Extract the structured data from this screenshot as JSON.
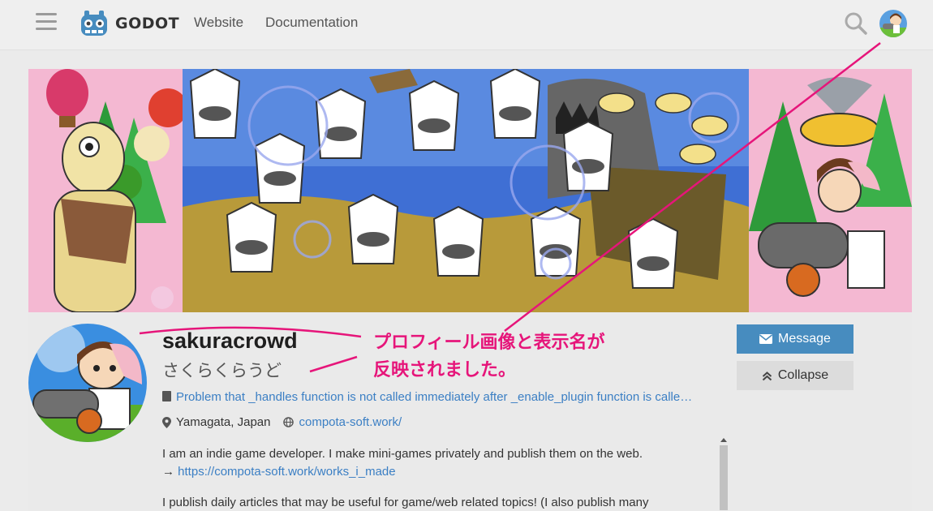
{
  "nav": {
    "logo_text": "GODOT",
    "links": [
      "Website",
      "Documentation"
    ]
  },
  "profile": {
    "username": "sakuracrowd",
    "display_name": "さくらくらうど",
    "latest_post": "Problem that _handles function is not called immediately after _enable_plugin function is calle…",
    "location": "Yamagata, Japan",
    "website": "compota-soft.work/",
    "bio": [
      {
        "text": "I am an indie game developer. I make mini-games privately and publish them on the web.",
        "arrow": "→ ",
        "link": "https://compota-soft.work/works_i_made"
      },
      {
        "text": "I publish daily articles that may be useful for game/web related topics! (I also publish many"
      }
    ]
  },
  "buttons": {
    "message": "Message",
    "collapse": "Collapse"
  },
  "annotation": {
    "line1": "プロフィール画像と表示名が",
    "line2": "反映されました。"
  },
  "colors": {
    "accent": "#478cbf",
    "link": "#3b7fc4",
    "annotation": "#e6157a"
  }
}
